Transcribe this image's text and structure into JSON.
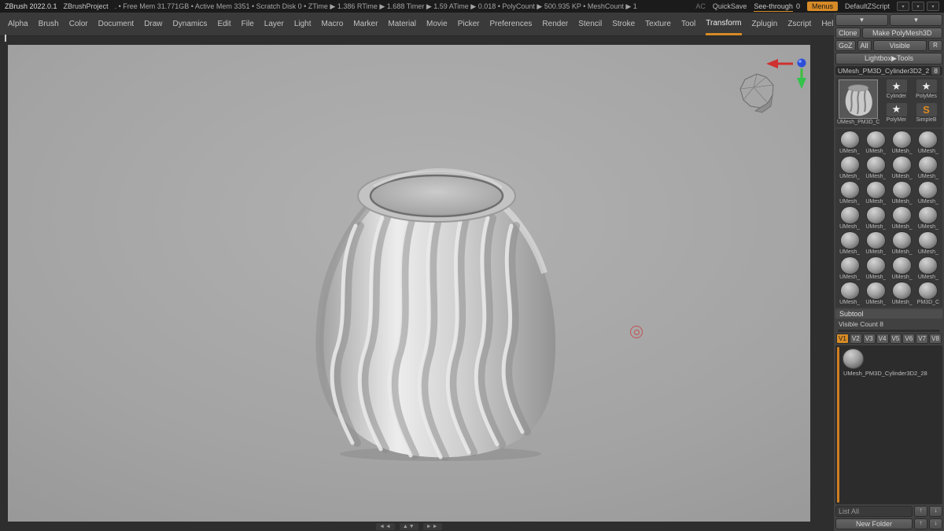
{
  "colors": {
    "accent": "#d78b26",
    "canvas_bg": "#a6a6a6",
    "panel_bg": "#414141"
  },
  "titlebar": {
    "app": "ZBrush 2022.0.1",
    "project": "ZBrushProject",
    "stats": ". • Free Mem 31.771GB • Active Mem 3351 • Scratch Disk 0 • ZTime ▶ 1.386 RTime ▶ 1.688 Timer ▶ 1.59 ATime ▶ 0.018 • PolyCount ▶ 500.935 KP • MeshCount ▶ 1",
    "ac": "AC",
    "quicksave": "QuickSave",
    "see_through_label": "See-through",
    "see_through_value": "0",
    "menus_button": "Menus",
    "default_script": "DefaultZScript",
    "win_icons": [
      "▾",
      "▾",
      "▾"
    ]
  },
  "menubar": {
    "items": [
      {
        "label": "Alpha"
      },
      {
        "label": "Brush"
      },
      {
        "label": "Color"
      },
      {
        "label": "Document"
      },
      {
        "label": "Draw"
      },
      {
        "label": "Dynamics"
      },
      {
        "label": "Edit"
      },
      {
        "label": "File"
      },
      {
        "label": "Layer"
      },
      {
        "label": "Light"
      },
      {
        "label": "Macro"
      },
      {
        "label": "Marker"
      },
      {
        "label": "Material"
      },
      {
        "label": "Movie"
      },
      {
        "label": "Picker"
      },
      {
        "label": "Preferences"
      },
      {
        "label": "Render"
      },
      {
        "label": "Stencil"
      },
      {
        "label": "Stroke"
      },
      {
        "label": "Texture"
      },
      {
        "label": "Tool"
      },
      {
        "label": "Transform",
        "active": true
      },
      {
        "label": "Zplugin"
      },
      {
        "label": "Zscript"
      },
      {
        "label": "Help"
      }
    ]
  },
  "canvas": {
    "nav": {
      "left": "◄◄",
      "vert": "▲▼",
      "right": "►►"
    }
  },
  "tool_panel": {
    "top_buttons": [
      "▾",
      "▾"
    ],
    "clone": "Clone",
    "make_polymesh": "Make PolyMesh3D",
    "goz": "GoZ",
    "all": "All",
    "visible": "Visible",
    "r": "R",
    "lightbox": "Lightbox▶Tools",
    "tool_name": "UMesh_PM3D_Cylinder3D2_2",
    "tool_name_badge": "8",
    "featured": {
      "active_label": "UMesh_PM3D_C",
      "small": [
        {
          "label": "Cylinder",
          "glyph": "★"
        },
        {
          "label": "PolyMes",
          "glyph": "★"
        },
        {
          "label": "PolyMer",
          "glyph": "★"
        },
        {
          "label": "SimpleB",
          "glyph": "S",
          "orange": true
        }
      ]
    },
    "grid": [
      "UMesh_",
      "UMesh_",
      "UMesh_",
      "UMesh_",
      "UMesh_",
      "UMesh_",
      "UMesh_",
      "UMesh_",
      "UMesh_",
      "UMesh_",
      "UMesh_",
      "UMesh_",
      "UMesh_",
      "UMesh_",
      "UMesh_",
      "UMesh_",
      "UMesh_",
      "UMesh_",
      "UMesh_",
      "UMesh_",
      "UMesh_",
      "UMesh_",
      "UMesh_",
      "UMesh_",
      "UMesh_",
      "UMesh_",
      "UMesh_",
      "PM3D_C"
    ]
  },
  "subtool": {
    "title": "Subtool",
    "visible_count": "Visible Count 8",
    "tabs": [
      {
        "label": "V1",
        "active": true
      },
      {
        "label": "V2"
      },
      {
        "label": "V3"
      },
      {
        "label": "V4"
      },
      {
        "label": "V5"
      },
      {
        "label": "V6"
      },
      {
        "label": "V7"
      },
      {
        "label": "V8"
      }
    ],
    "items": [
      {
        "label": "UMesh_PM3D_Cylinder3D2_28"
      }
    ],
    "list_all": "List All",
    "list_all_icons": [
      "↑",
      "↓"
    ],
    "new_folder": "New Folder",
    "new_folder_icons": [
      "↑",
      "↓"
    ]
  }
}
